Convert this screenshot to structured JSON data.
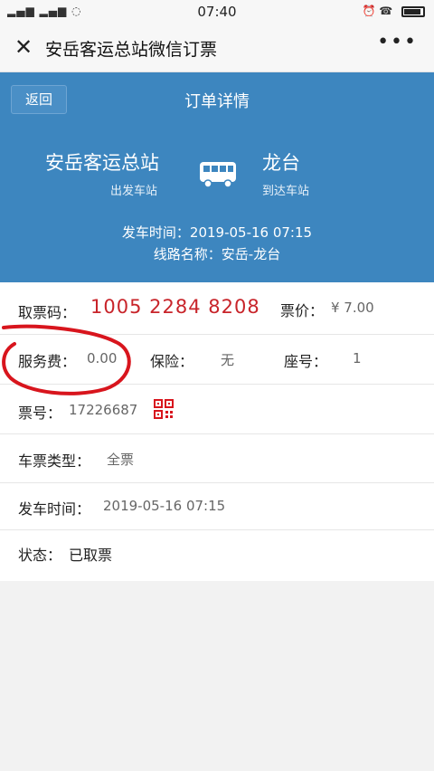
{
  "status_bar": {
    "signal": "▂▄▆ ▂▄▆ ◌",
    "time": "07:40",
    "icons": "⏰ ☎"
  },
  "title_bar": {
    "close_icon": "✕",
    "title": "安岳客运总站微信订票",
    "more_icon": "•••"
  },
  "hero": {
    "back_label": "返回",
    "page_title": "订单详情",
    "from_station": "安岳客运总站",
    "from_label": "出发车站",
    "to_station": "龙台",
    "to_label": "到达车站",
    "depart_time_line": "发车时间：2019-05-16 07:15",
    "route_line": "线路名称：安岳-龙台"
  },
  "ticket": {
    "code_label": "取票码：",
    "code_value": "1005 2284 8208",
    "price_label": "票价：",
    "price_value": "¥ 7.00",
    "service_fee_label": "服务费：",
    "service_fee_value": "0.00",
    "insurance_label": "保险：",
    "insurance_value": "无",
    "seat_label": "座号：",
    "seat_value": "1",
    "ticket_no_label": "票号：",
    "ticket_no_value": "17226687",
    "ticket_type_label": "车票类型：",
    "ticket_type_value": "全票",
    "depart_label": "发车时间：",
    "depart_value": "2019-05-16 07:15",
    "status_label": "状态：",
    "status_value": "已取票"
  },
  "colors": {
    "header_blue": "#3d86bf",
    "code_red": "#c8242a",
    "annotation_red": "#d8151d"
  }
}
